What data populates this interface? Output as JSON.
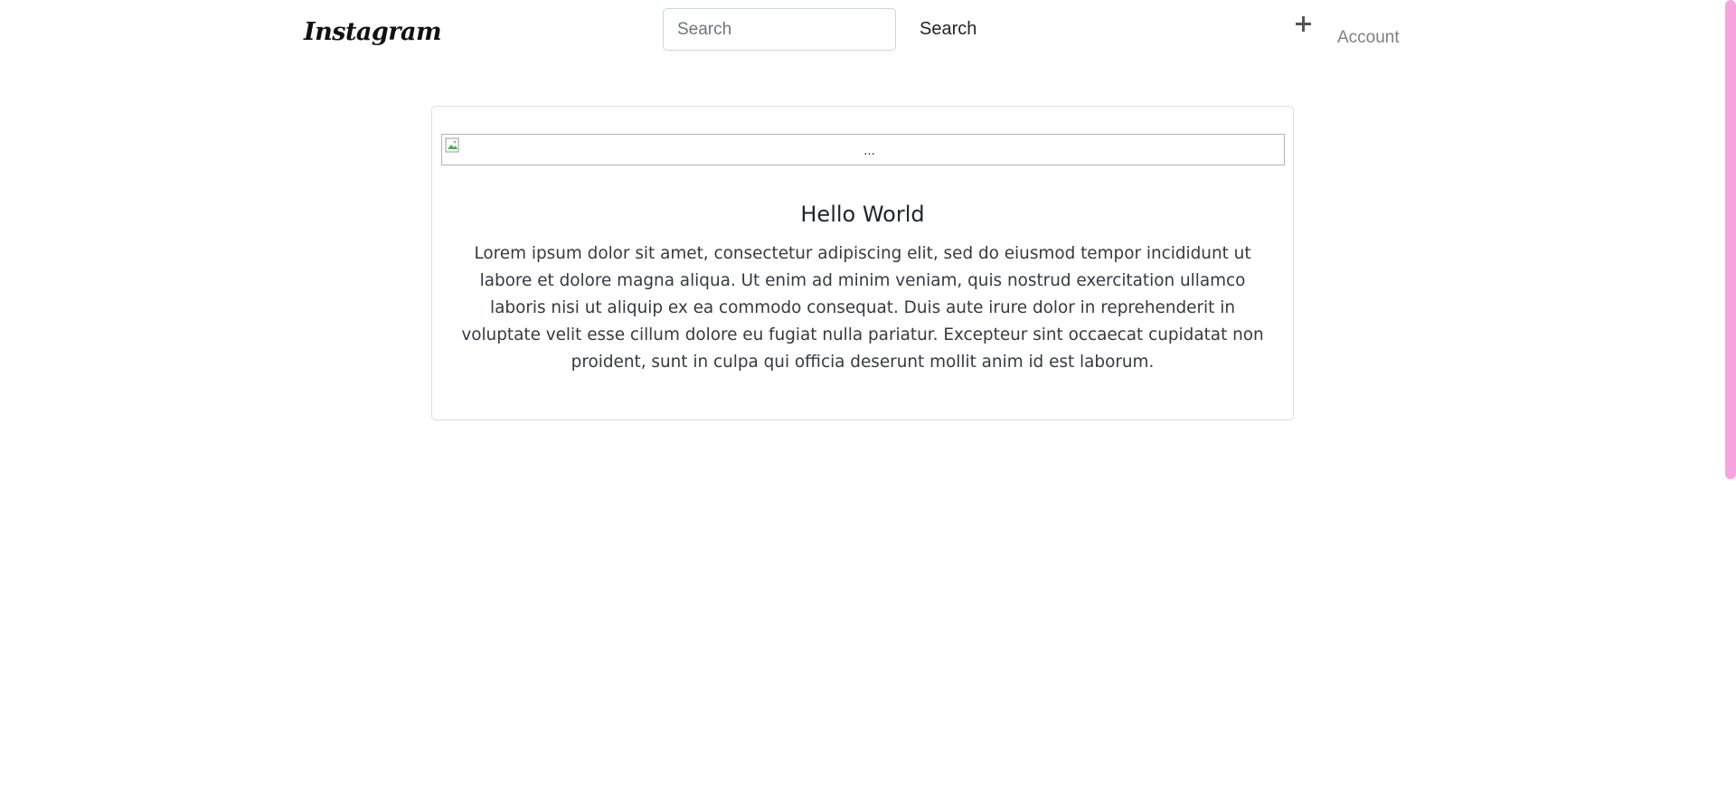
{
  "navbar": {
    "brand": "Instagram",
    "search": {
      "placeholder": "Search",
      "value": "",
      "button_label": "Search"
    },
    "add_icon": "plus-icon",
    "account_label": "Account"
  },
  "post": {
    "image_alt": "...",
    "title": "Hello World",
    "body": "Lorem ipsum dolor sit amet, consectetur adipiscing elit, sed do eiusmod tempor incididunt ut labore et dolore magna aliqua. Ut enim ad minim veniam, quis nostrud exercitation ullamco laboris nisi ut aliquip ex ea commodo consequat. Duis aute irure dolor in reprehenderit in voluptate velit esse cillum dolore eu fugiat nulla pariatur. Excepteur sint occaecat cupidatat non proident, sunt in culpa qui officia deserunt mollit anim id est laborum."
  },
  "colors": {
    "scrollbar_thumb": "#f6a3de",
    "account_link": "#7f7f7f",
    "card_border": "#dfdfdf"
  }
}
